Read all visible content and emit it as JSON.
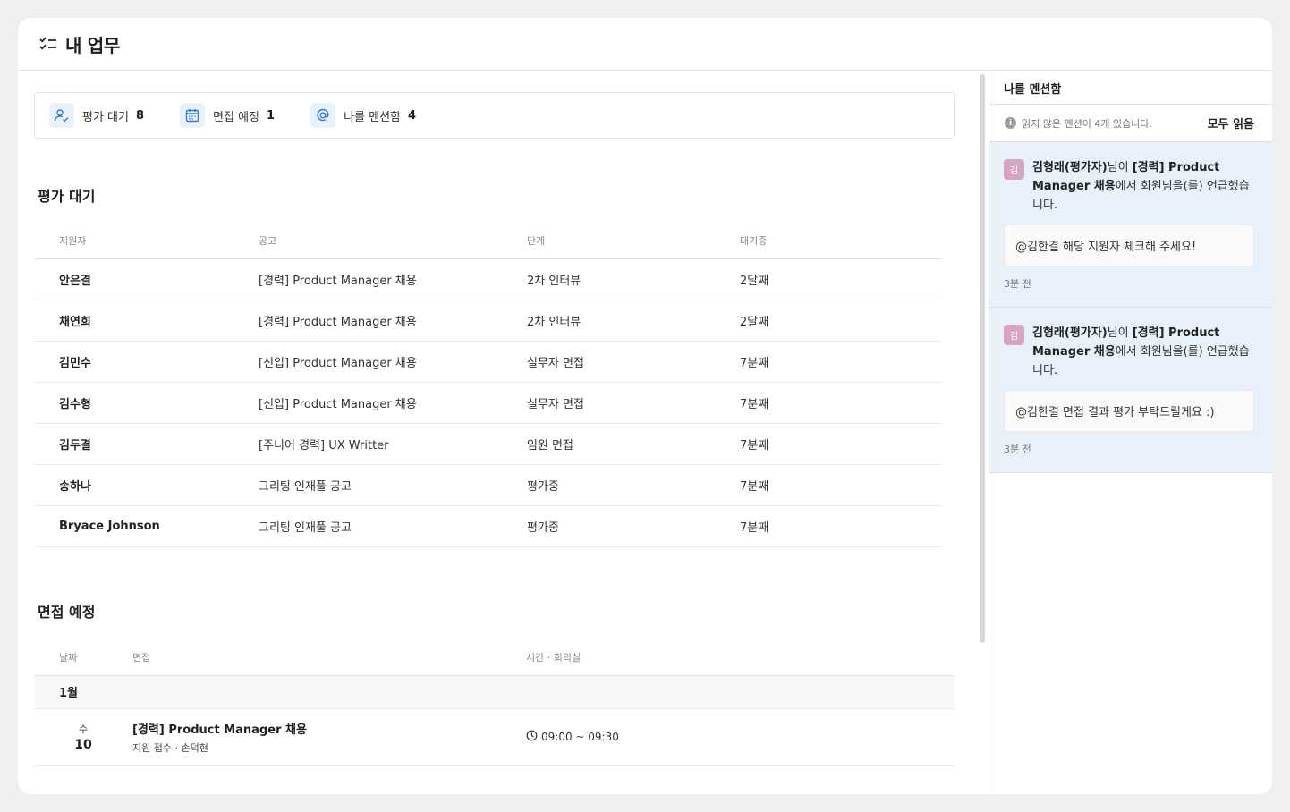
{
  "page": {
    "title": "내 업무",
    "title_icon": "checklist-icon"
  },
  "summary": [
    {
      "icon": "user-check-icon",
      "label": "평가 대기",
      "count": "8"
    },
    {
      "icon": "calendar-icon",
      "label": "면접 예정",
      "count": "1"
    },
    {
      "icon": "at-sign-icon",
      "label": "나를 멘션함",
      "count": "4"
    }
  ],
  "evaluation": {
    "title": "평가 대기",
    "headers": [
      "지원자",
      "공고",
      "단계",
      "대기중"
    ],
    "rows": [
      {
        "name": "안은결",
        "posting": "[경력] Product Manager 채용",
        "stage": "2차 인터뷰",
        "waiting": "2달째"
      },
      {
        "name": "채연희",
        "posting": "[경력] Product Manager 채용",
        "stage": "2차 인터뷰",
        "waiting": "2달째"
      },
      {
        "name": "김민수",
        "posting": "[신입] Product Manager 채용",
        "stage": "실무자 면접",
        "waiting": "7분째"
      },
      {
        "name": "김수형",
        "posting": "[신입] Product Manager 채용",
        "stage": "실무자 면접",
        "waiting": "7분째"
      },
      {
        "name": "김두결",
        "posting": "[주니어 경력] UX Writter",
        "stage": "임원 면접",
        "waiting": "7분째"
      },
      {
        "name": "송하나",
        "posting": "그리팅 인재풀 공고",
        "stage": "평가중",
        "waiting": "7분째"
      },
      {
        "name": "Bryace Johnson",
        "posting": "그리팅 인재풀 공고",
        "stage": "평가중",
        "waiting": "7분째"
      }
    ]
  },
  "interviews": {
    "title": "면접 예정",
    "headers": [
      "날짜",
      "면접",
      "시간 · 회의실"
    ],
    "month": "1월",
    "items": [
      {
        "dow": "수",
        "day": "10",
        "title": "[경력] Product Manager 채용",
        "sub": "지원 접수 · 손덕현",
        "time": "09:00 ~ 09:30"
      }
    ]
  },
  "mentions_panel": {
    "title": "나를 멘션함",
    "notice": "읽지 않은 멘션이 4개 있습니다.",
    "read_all": "모두 읽음",
    "items": [
      {
        "avatar": "김",
        "author": "김형래(평가자)",
        "mid1": "님이 ",
        "posting": "[경력] Product Manager 채용",
        "mid2": "에서 회원님을(를) 언급했습니다.",
        "message": "@김한결 해당 지원자 체크해 주세요!",
        "time": "3분 전"
      },
      {
        "avatar": "김",
        "author": "김형래(평가자)",
        "mid1": "님이 ",
        "posting": "[경력] Product Manager 채용",
        "mid2": "에서 회원님을(를) 언급했습니다.",
        "message": "@김한결 면접 결과 평가 부탁드릴게요 :)",
        "time": "3분 전"
      }
    ]
  },
  "colors": {
    "accent": "#2f7be0",
    "mention_bg": "#e8f0fa",
    "avatar": "#d6a5c6"
  }
}
